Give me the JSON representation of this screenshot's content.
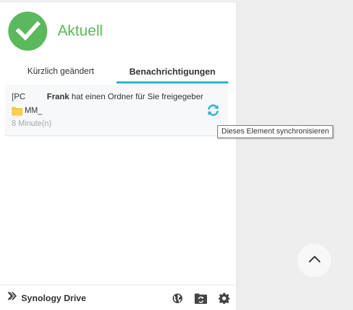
{
  "status": {
    "title": "Aktuell",
    "icon": "check-circle-icon",
    "color": "#5cb85c"
  },
  "tabs": [
    {
      "label": "Kürzlich geändert",
      "active": false
    },
    {
      "label": "Benachrichtigungen",
      "active": true
    }
  ],
  "notification": {
    "prefix": "[PC",
    "sender": "Frank",
    "message": "hat einen Ordner für Sie freigegeber",
    "folder_name": "MM_",
    "time": "8 Minute(n)",
    "action_icon": "sync-icon"
  },
  "tooltip": {
    "text": "Dieses Element synchronisieren"
  },
  "footer": {
    "brand": "Synology Drive",
    "icons": [
      "globe-icon",
      "folder-sync-icon",
      "gear-icon"
    ]
  },
  "accent_color": "#2ab2c4"
}
